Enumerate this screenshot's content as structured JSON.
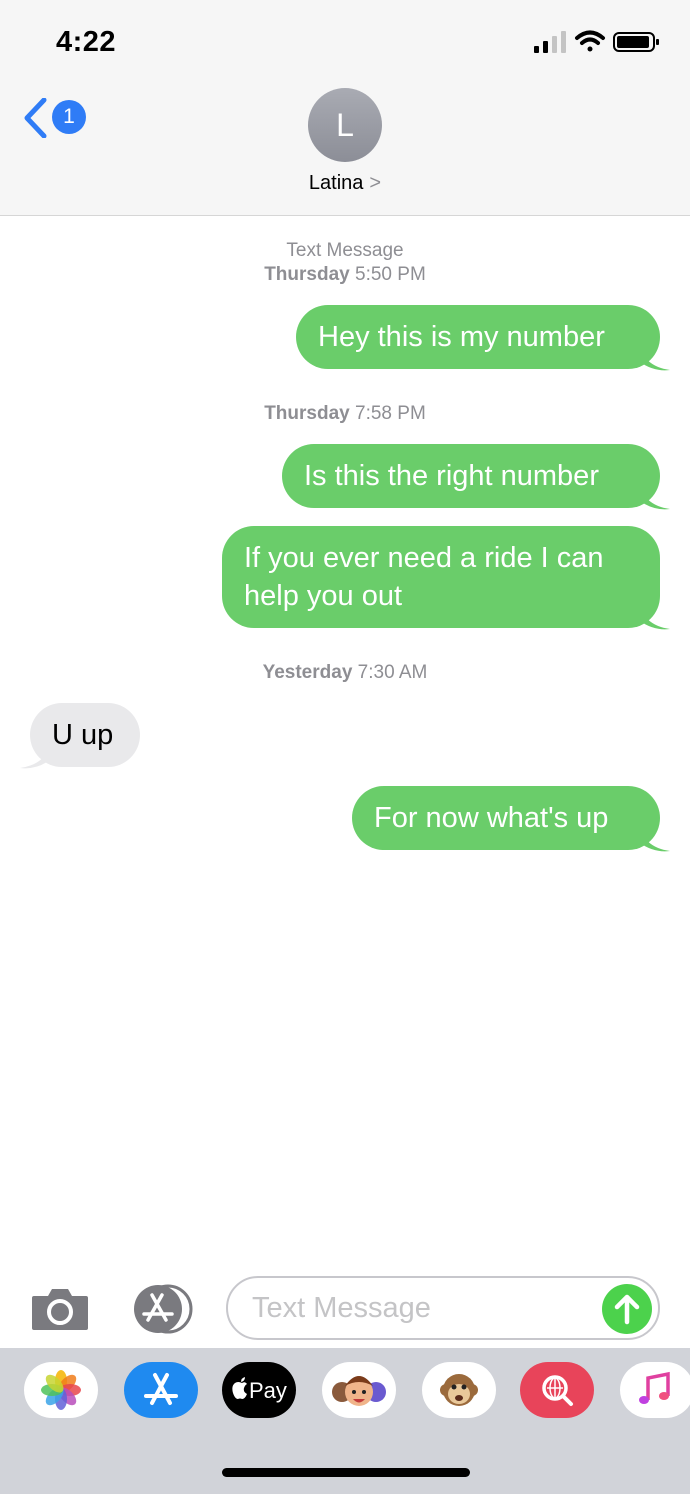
{
  "status_bar": {
    "time": "4:22"
  },
  "nav": {
    "back_badge": "1",
    "avatar_initial": "L",
    "contact_name": "Latina",
    "contact_chevron": ">"
  },
  "stamps": [
    {
      "line1": "Text Message",
      "day": "Thursday",
      "time": "5:50 PM"
    },
    {
      "day": "Thursday",
      "time": "7:58 PM"
    },
    {
      "day": "Yesterday",
      "time": "7:30 AM"
    }
  ],
  "messages": [
    {
      "direction": "outgoing",
      "text": "Hey this is my number"
    },
    {
      "direction": "outgoing",
      "text": "Is this the right number"
    },
    {
      "direction": "outgoing",
      "text": "If you ever need a ride I can help you out"
    },
    {
      "direction": "incoming",
      "text": "U up"
    },
    {
      "direction": "outgoing",
      "text": "For now what's up"
    }
  ],
  "input": {
    "placeholder": "Text Message"
  },
  "drawer_apps": [
    {
      "icon": "photos-icon"
    },
    {
      "icon": "app-store-icon"
    },
    {
      "icon": "apple-pay-icon",
      "label": "Pay"
    },
    {
      "icon": "memoji-icon"
    },
    {
      "icon": "animoji-monkey-icon"
    },
    {
      "icon": "web-images-search-icon"
    },
    {
      "icon": "music-icon"
    }
  ],
  "colors": {
    "outgoing_bubble": "#6acd6a",
    "incoming_bubble": "#e9e9eb",
    "accent_blue": "#2f7cf6",
    "send_button": "#4cd24c"
  }
}
